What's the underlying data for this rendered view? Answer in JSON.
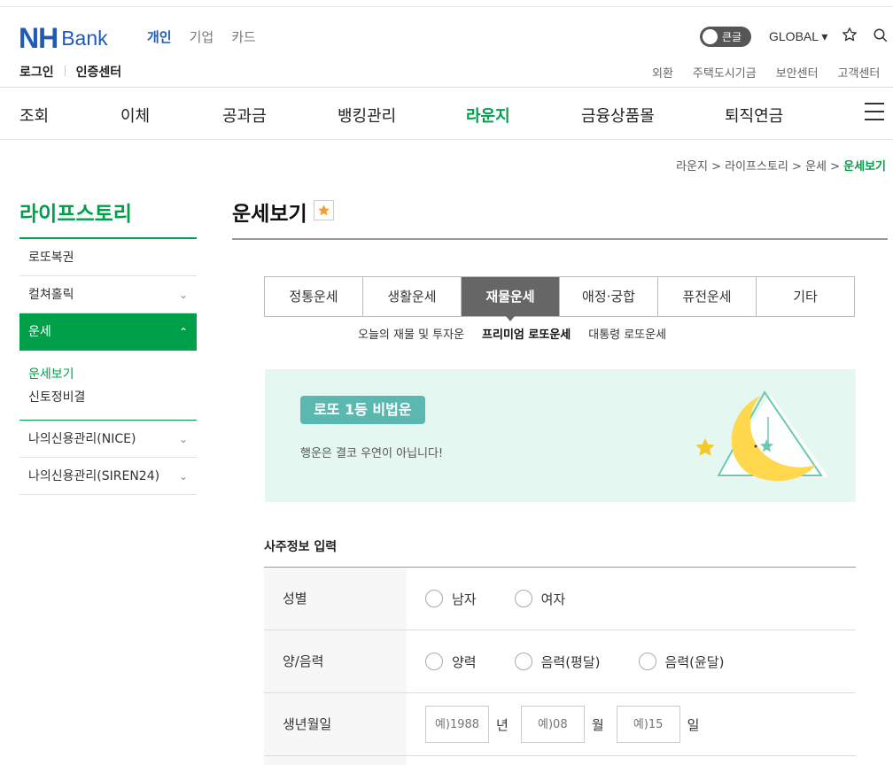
{
  "header": {
    "logo_nh": "NH",
    "logo_bank": "Bank",
    "business_tabs": [
      {
        "label": "개인",
        "active": true
      },
      {
        "label": "기업",
        "active": false
      },
      {
        "label": "카드",
        "active": false
      }
    ],
    "toggle_label": "큰글",
    "global_label": "GLOBAL ▾",
    "login": [
      "로그인",
      "인증센터"
    ],
    "utility_links": [
      "외환",
      "주택도시기금",
      "보안센터",
      "고객센터"
    ],
    "gnb": [
      {
        "label": "조회",
        "active": false
      },
      {
        "label": "이체",
        "active": false
      },
      {
        "label": "공과금",
        "active": false
      },
      {
        "label": "뱅킹관리",
        "active": false
      },
      {
        "label": "라운지",
        "active": true
      },
      {
        "label": "금융상품몰",
        "active": false
      },
      {
        "label": "퇴직연금",
        "active": false
      }
    ]
  },
  "breadcrumb": {
    "items": [
      "라운지",
      "라이프스토리",
      "운세"
    ],
    "separator": " > ",
    "current": "운세보기"
  },
  "lnb": {
    "title": "라이프스토리",
    "items": [
      {
        "label": "로또복권",
        "chevron": ""
      },
      {
        "label": "컬쳐홀릭",
        "chevron": "⌄"
      },
      {
        "label": "운세",
        "chevron": "⌃",
        "active": true
      },
      {
        "label": "나의신용관리(NICE)",
        "chevron": "⌄"
      },
      {
        "label": "나의신용관리(SIREN24)",
        "chevron": "⌄"
      }
    ],
    "sub_items": [
      {
        "label": "운세보기",
        "active": true
      },
      {
        "label": "신토정비결",
        "active": false
      }
    ]
  },
  "page": {
    "title": "운세보기",
    "tabs": [
      {
        "label": "정통운세",
        "active": false
      },
      {
        "label": "생활운세",
        "active": false
      },
      {
        "label": "재물운세",
        "active": true
      },
      {
        "label": "애정·궁합",
        "active": false
      },
      {
        "label": "퓨전운세",
        "active": false
      },
      {
        "label": "기타",
        "active": false
      }
    ],
    "subtabs": [
      {
        "label": "오늘의 재물 및 투자운",
        "active": false
      },
      {
        "label": "프리미엄 로또운세",
        "active": true
      },
      {
        "label": "대통령 로또운세",
        "active": false
      }
    ],
    "banner": {
      "tag": "로또 1등 비법운",
      "description": "행운은 결코 우연이 아닙니다!"
    },
    "form": {
      "title": "사주정보 입력",
      "gender": {
        "label": "성별",
        "options": [
          "남자",
          "여자"
        ]
      },
      "calendar": {
        "label": "양/음력",
        "options": [
          "양력",
          "음력(평달)",
          "음력(윤달)"
        ]
      },
      "birth": {
        "label": "생년월일",
        "year_placeholder": "예)1988",
        "year_unit": "년",
        "month_placeholder": "예)08",
        "month_unit": "월",
        "day_placeholder": "예)15",
        "day_unit": "일"
      }
    }
  },
  "colors": {
    "brand_blue": "#1e5bb8",
    "brand_green": "#00a04b",
    "tab_active": "#666666",
    "banner_bg": "#e5f7f1",
    "banner_tag": "#5bb8b0",
    "moon": "#ffd84d"
  }
}
